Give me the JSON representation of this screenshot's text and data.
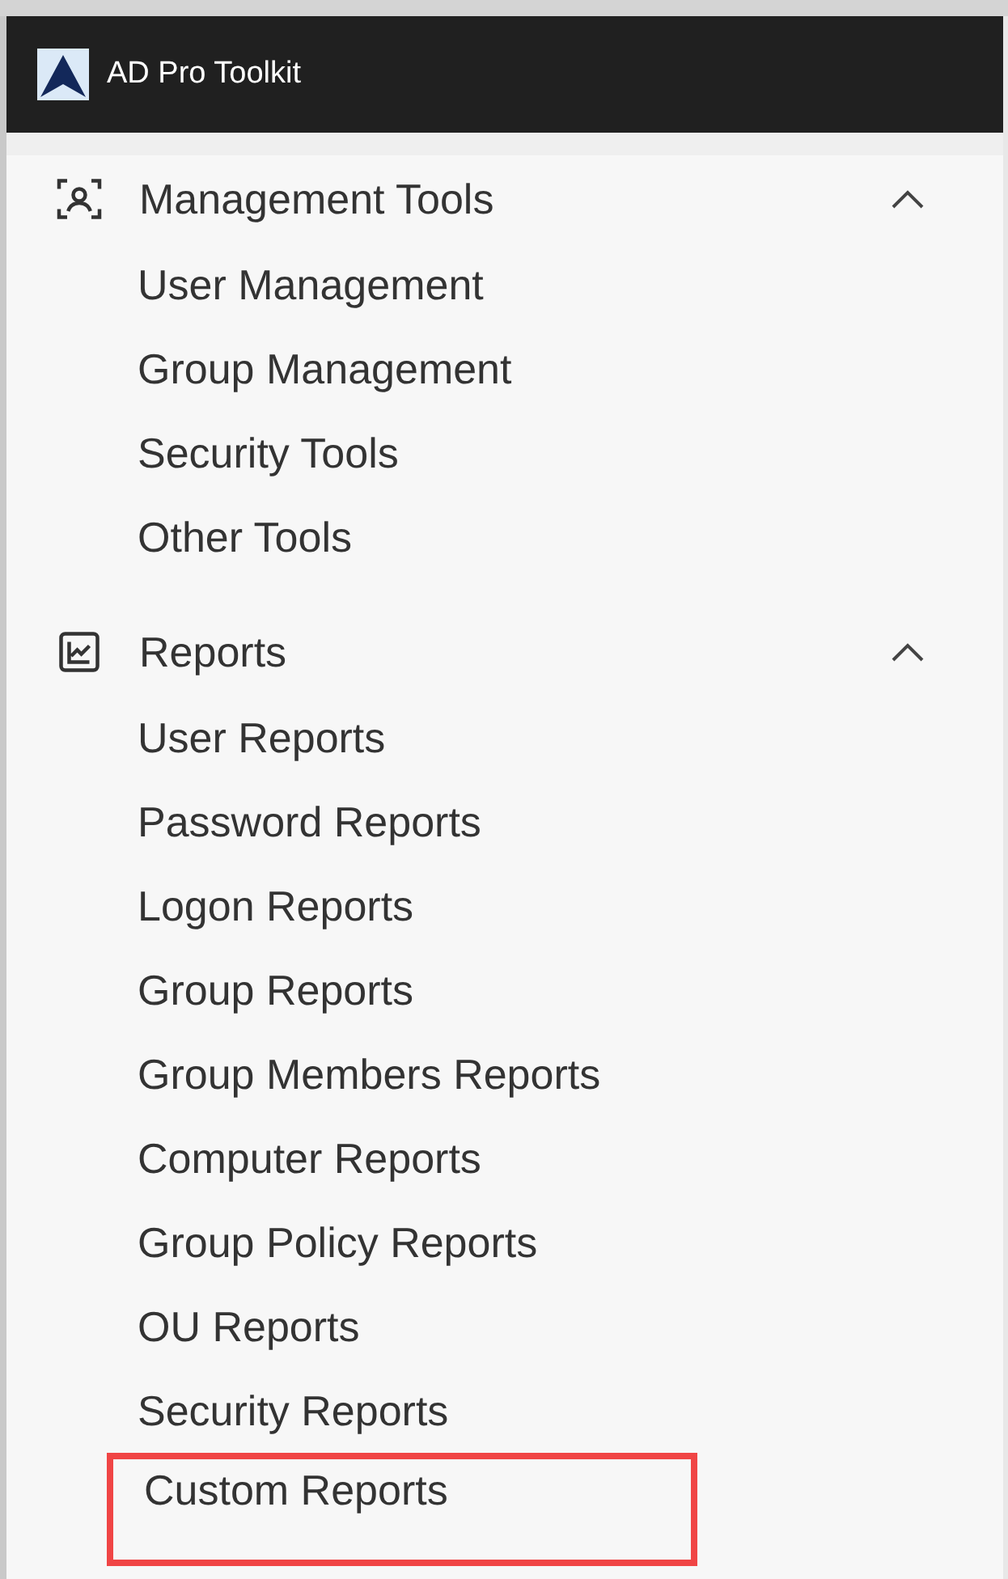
{
  "app": {
    "title": "AD Pro Toolkit"
  },
  "sections": [
    {
      "title": "Management Tools",
      "expanded": true,
      "items": [
        {
          "label": "User Management",
          "highlighted": false
        },
        {
          "label": "Group Management",
          "highlighted": false
        },
        {
          "label": "Security Tools",
          "highlighted": false
        },
        {
          "label": "Other Tools",
          "highlighted": false
        }
      ]
    },
    {
      "title": "Reports",
      "expanded": true,
      "items": [
        {
          "label": "User Reports",
          "highlighted": false
        },
        {
          "label": "Password Reports",
          "highlighted": false
        },
        {
          "label": "Logon Reports",
          "highlighted": false
        },
        {
          "label": "Group Reports",
          "highlighted": false
        },
        {
          "label": "Group Members Reports",
          "highlighted": false
        },
        {
          "label": "Computer Reports",
          "highlighted": false
        },
        {
          "label": "Group Policy Reports",
          "highlighted": false
        },
        {
          "label": "OU Reports",
          "highlighted": false
        },
        {
          "label": "Security Reports",
          "highlighted": false
        },
        {
          "label": "Custom Reports",
          "highlighted": true
        }
      ]
    }
  ]
}
